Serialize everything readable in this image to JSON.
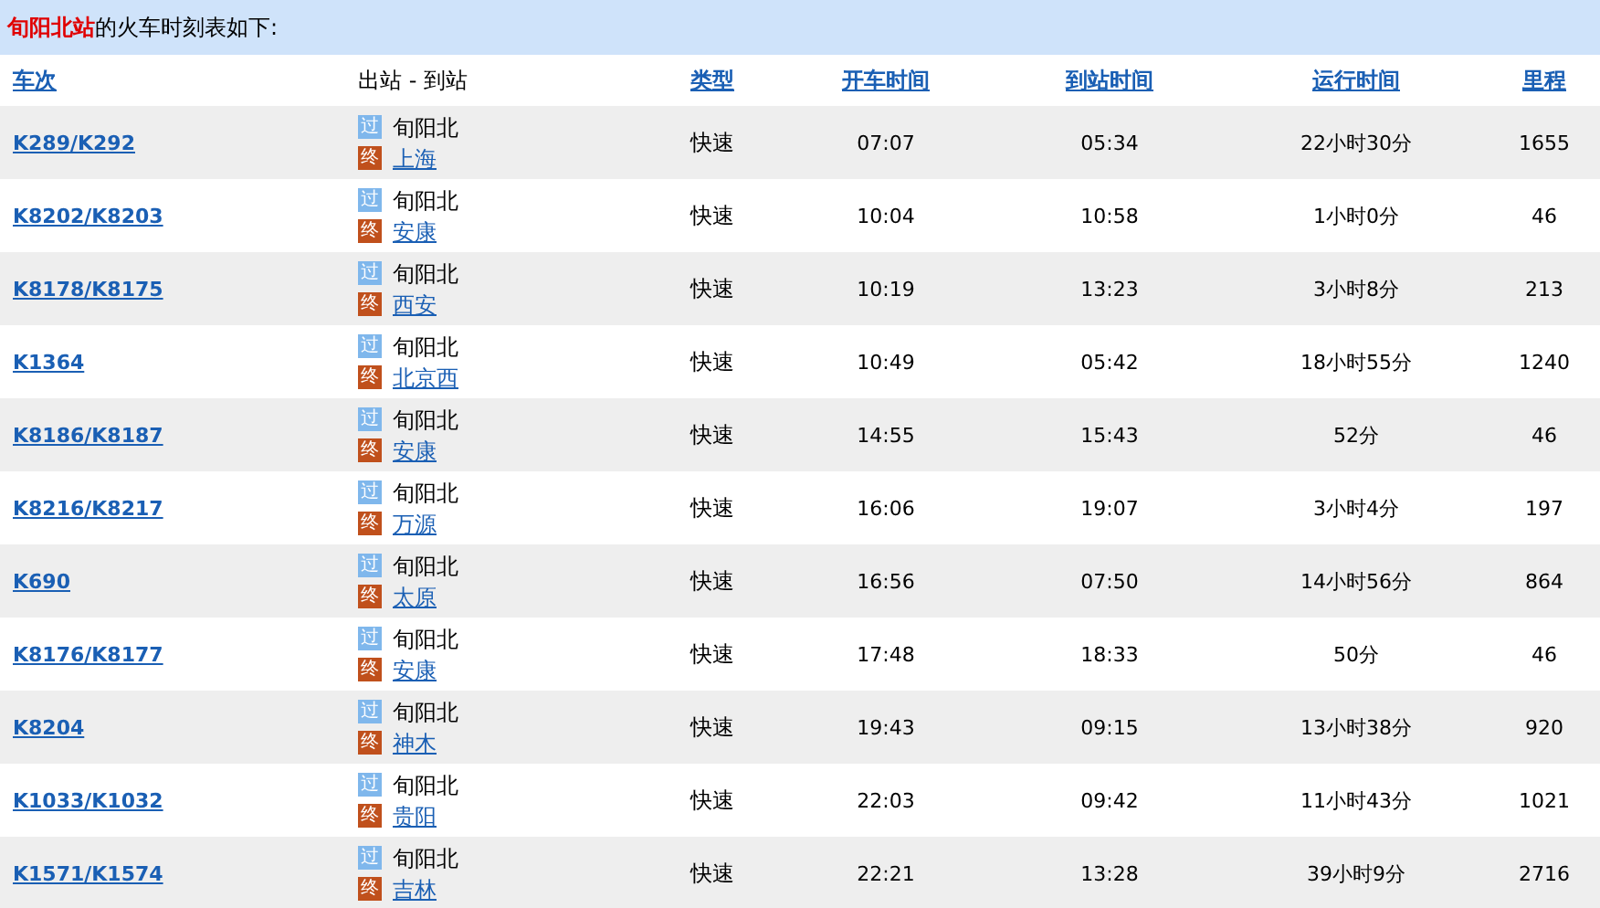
{
  "title": "**旬阳北站**的火车时刻表如下:",
  "columns": [
    {
      "label": "车次",
      "link": true
    },
    {
      "label": "出站 - 到站",
      "link": false
    },
    {
      "label": "类型",
      "link": true
    },
    {
      "label": "开车时间",
      "link": true
    },
    {
      "label": "到站时间",
      "link": true
    },
    {
      "label": "运行时间",
      "link": true
    },
    {
      "label": "里程",
      "link": true
    }
  ],
  "rows": [
    {
      "train": "K289/K292",
      "pass_badge": "过",
      "end_badge": "终",
      "from": "旬阳北",
      "to": "上海",
      "type": "快速",
      "depart": "07:07",
      "arrive": "05:34",
      "duration": "22小时30分",
      "distance": "1655"
    },
    {
      "train": "K8202/K8203",
      "pass_badge": "过",
      "end_badge": "终",
      "from": "旬阳北",
      "to": "安康",
      "type": "快速",
      "depart": "10:04",
      "arrive": "10:58",
      "duration": "1小时0分",
      "distance": "46"
    },
    {
      "train": "K8178/K8175",
      "pass_badge": "过",
      "end_badge": "终",
      "from": "旬阳北",
      "to": "西安",
      "type": "快速",
      "depart": "10:19",
      "arrive": "13:23",
      "duration": "3小时8分",
      "distance": "213"
    },
    {
      "train": "K1364",
      "pass_badge": "过",
      "end_badge": "终",
      "from": "旬阳北",
      "to": "北京西",
      "type": "快速",
      "depart": "10:49",
      "arrive": "05:42",
      "duration": "18小时55分",
      "distance": "1240"
    },
    {
      "train": "K8186/K8187",
      "pass_badge": "过",
      "end_badge": "终",
      "from": "旬阳北",
      "to": "安康",
      "type": "快速",
      "depart": "14:55",
      "arrive": "15:43",
      "duration": "52分",
      "distance": "46"
    },
    {
      "train": "K8216/K8217",
      "pass_badge": "过",
      "end_badge": "终",
      "from": "旬阳北",
      "to": "万源",
      "type": "快速",
      "depart": "16:06",
      "arrive": "19:07",
      "duration": "3小时4分",
      "distance": "197"
    },
    {
      "train": "K690",
      "pass_badge": "过",
      "end_badge": "终",
      "from": "旬阳北",
      "to": "太原",
      "type": "快速",
      "depart": "16:56",
      "arrive": "07:50",
      "duration": "14小时56分",
      "distance": "864"
    },
    {
      "train": "K8176/K8177",
      "pass_badge": "过",
      "end_badge": "终",
      "from": "旬阳北",
      "to": "安康",
      "type": "快速",
      "depart": "17:48",
      "arrive": "18:33",
      "duration": "50分",
      "distance": "46"
    },
    {
      "train": "K8204",
      "pass_badge": "过",
      "end_badge": "终",
      "from": "旬阳北",
      "to": "神木",
      "type": "快速",
      "depart": "19:43",
      "arrive": "09:15",
      "duration": "13小时38分",
      "distance": "920"
    },
    {
      "train": "K1033/K1032",
      "pass_badge": "过",
      "end_badge": "终",
      "from": "旬阳北",
      "to": "贵阳",
      "type": "快速",
      "depart": "22:03",
      "arrive": "09:42",
      "duration": "11小时43分",
      "distance": "1021"
    },
    {
      "train": "K1571/K1574",
      "pass_badge": "过",
      "end_badge": "终",
      "from": "旬阳北",
      "to": "吉林",
      "type": "快速",
      "depart": "22:21",
      "arrive": "13:28",
      "duration": "39小时9分",
      "distance": "2716"
    }
  ]
}
